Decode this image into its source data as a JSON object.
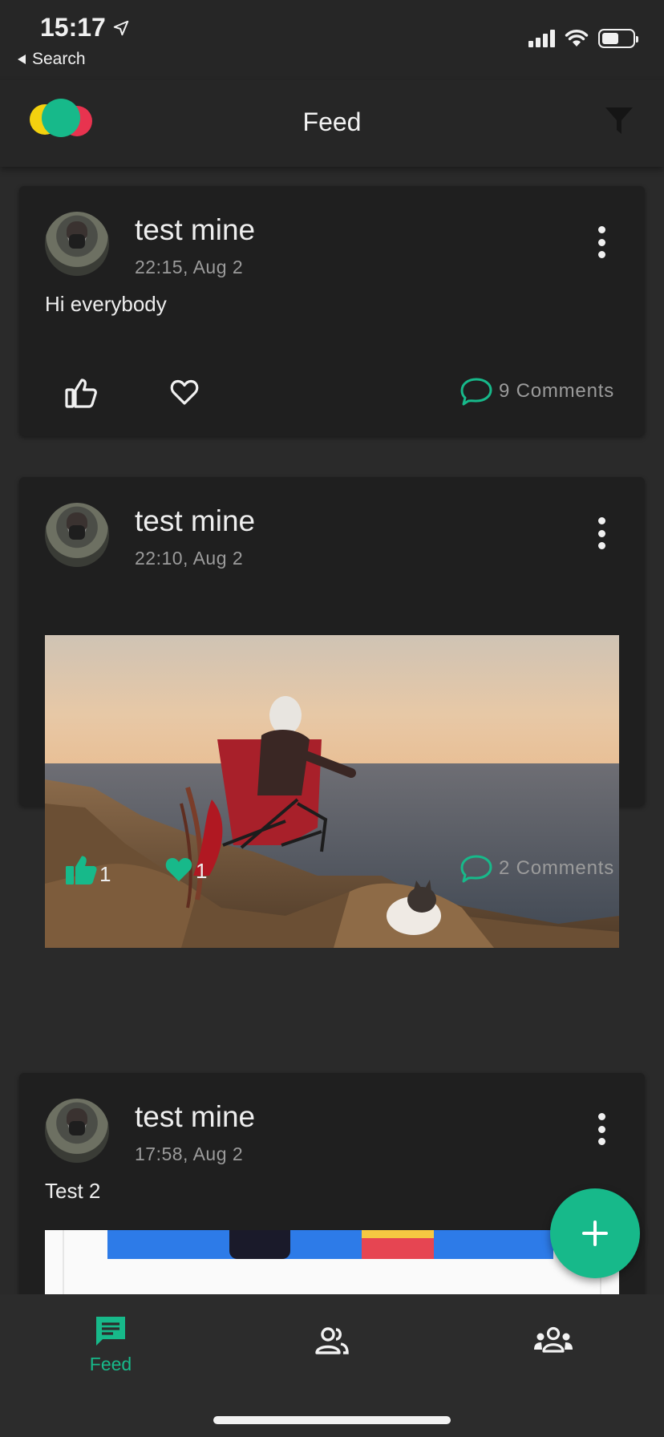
{
  "status": {
    "time": "15:17",
    "back_label": "Search"
  },
  "header": {
    "title": "Feed"
  },
  "posts": [
    {
      "author": "test mine",
      "time": "22:15, Aug 2",
      "text": "Hi everybody",
      "comments": "9 Comments"
    },
    {
      "author": "test mine",
      "time": "22:10, Aug 2",
      "likes": "1",
      "hearts": "1",
      "comments": "2 Comments"
    },
    {
      "author": "test mine",
      "time": "17:58, Aug 2",
      "text": "Test 2"
    }
  ],
  "nav": {
    "feed_label": "Feed"
  },
  "colors": {
    "accent": "#17b98a",
    "card": "#1f1f1f",
    "background": "#2a2a2a"
  },
  "icons": [
    "location-arrow-icon",
    "signal-icon",
    "wifi-icon",
    "battery-icon",
    "filter-icon",
    "like-icon",
    "heart-icon",
    "comment-icon",
    "more-vertical-icon",
    "plus-icon",
    "feed-icon",
    "friends-icon",
    "groups-icon"
  ]
}
